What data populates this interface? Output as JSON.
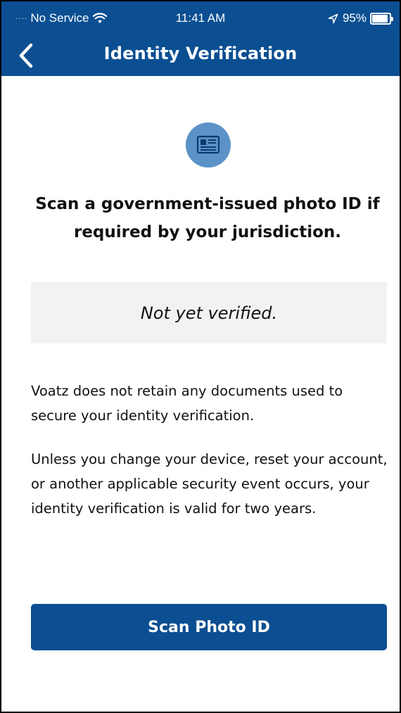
{
  "status_bar": {
    "signal_dots": "....",
    "carrier": "No Service",
    "time": "11:41 AM",
    "battery": "95%"
  },
  "header": {
    "title": "Identity Verification",
    "back_icon": "chevron-left-icon"
  },
  "main": {
    "icon": "id-card-icon",
    "headline": "Scan a government-issued photo ID if required by your jurisdiction.",
    "verification_status": "Not yet verified.",
    "paragraphs": [
      "Voatz does not retain any documents used to secure your identity verification.",
      "Unless you change your device, reset your account, or another applicable security event occurs, your identity verification is valid for two years."
    ],
    "scan_button_label": "Scan Photo ID"
  },
  "colors": {
    "brand_blue": "#0b4f92",
    "icon_blue": "#5b92c7",
    "status_box_bg": "#f2f2f5"
  }
}
